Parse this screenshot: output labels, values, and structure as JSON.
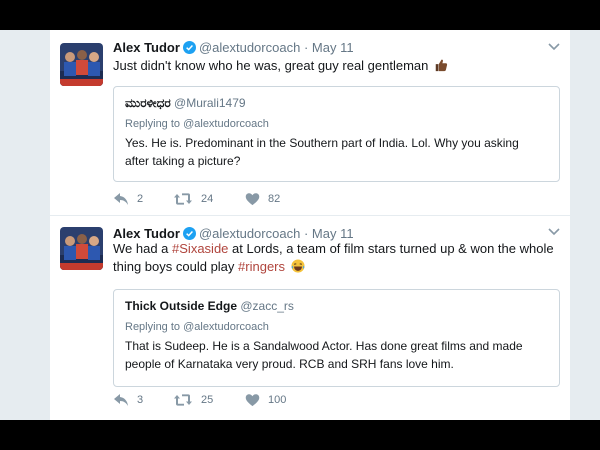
{
  "tweets": [
    {
      "name": "Alex Tudor",
      "handle": "@alextudorcoach",
      "separator": "·",
      "date": "May 11",
      "text": "Just didn't know who he was, great guy real gentleman",
      "emoji": "thumbs-up-icon",
      "quote": {
        "name": "ಮುರಳೀಧರ",
        "handle": "@Murali1479",
        "replying": "Replying to @alextudorcoach",
        "text": "Yes. He is. Predominant in the Southern part of India. Lol. Why you asking after taking a picture?"
      },
      "replies": "2",
      "retweets": "24",
      "likes": "82"
    },
    {
      "name": "Alex Tudor",
      "handle": "@alextudorcoach",
      "separator": "·",
      "date": "May 11",
      "text_a": "We had a ",
      "hashtag1": "#Sixaside",
      "text_b": " at Lords, a team of film stars turned up & won the whole thing boys could play ",
      "hashtag2": "#ringers",
      "emoji": "laughing-emoji-icon",
      "quote": {
        "name": "Thick Outside Edge",
        "handle": "@zacc_rs",
        "replying": "Replying to @alextudorcoach",
        "text": "That is Sudeep. He is a Sandalwood Actor. Has done great films and made people of Karnataka very proud. RCB and SRH fans love him."
      },
      "replies": "3",
      "retweets": "25",
      "likes": "100"
    }
  ],
  "colors": {
    "text": "#14171a",
    "muted": "#657786",
    "hashtag": "#b0453d",
    "verified": "#1da1f2",
    "background": "#e6ecf0"
  }
}
